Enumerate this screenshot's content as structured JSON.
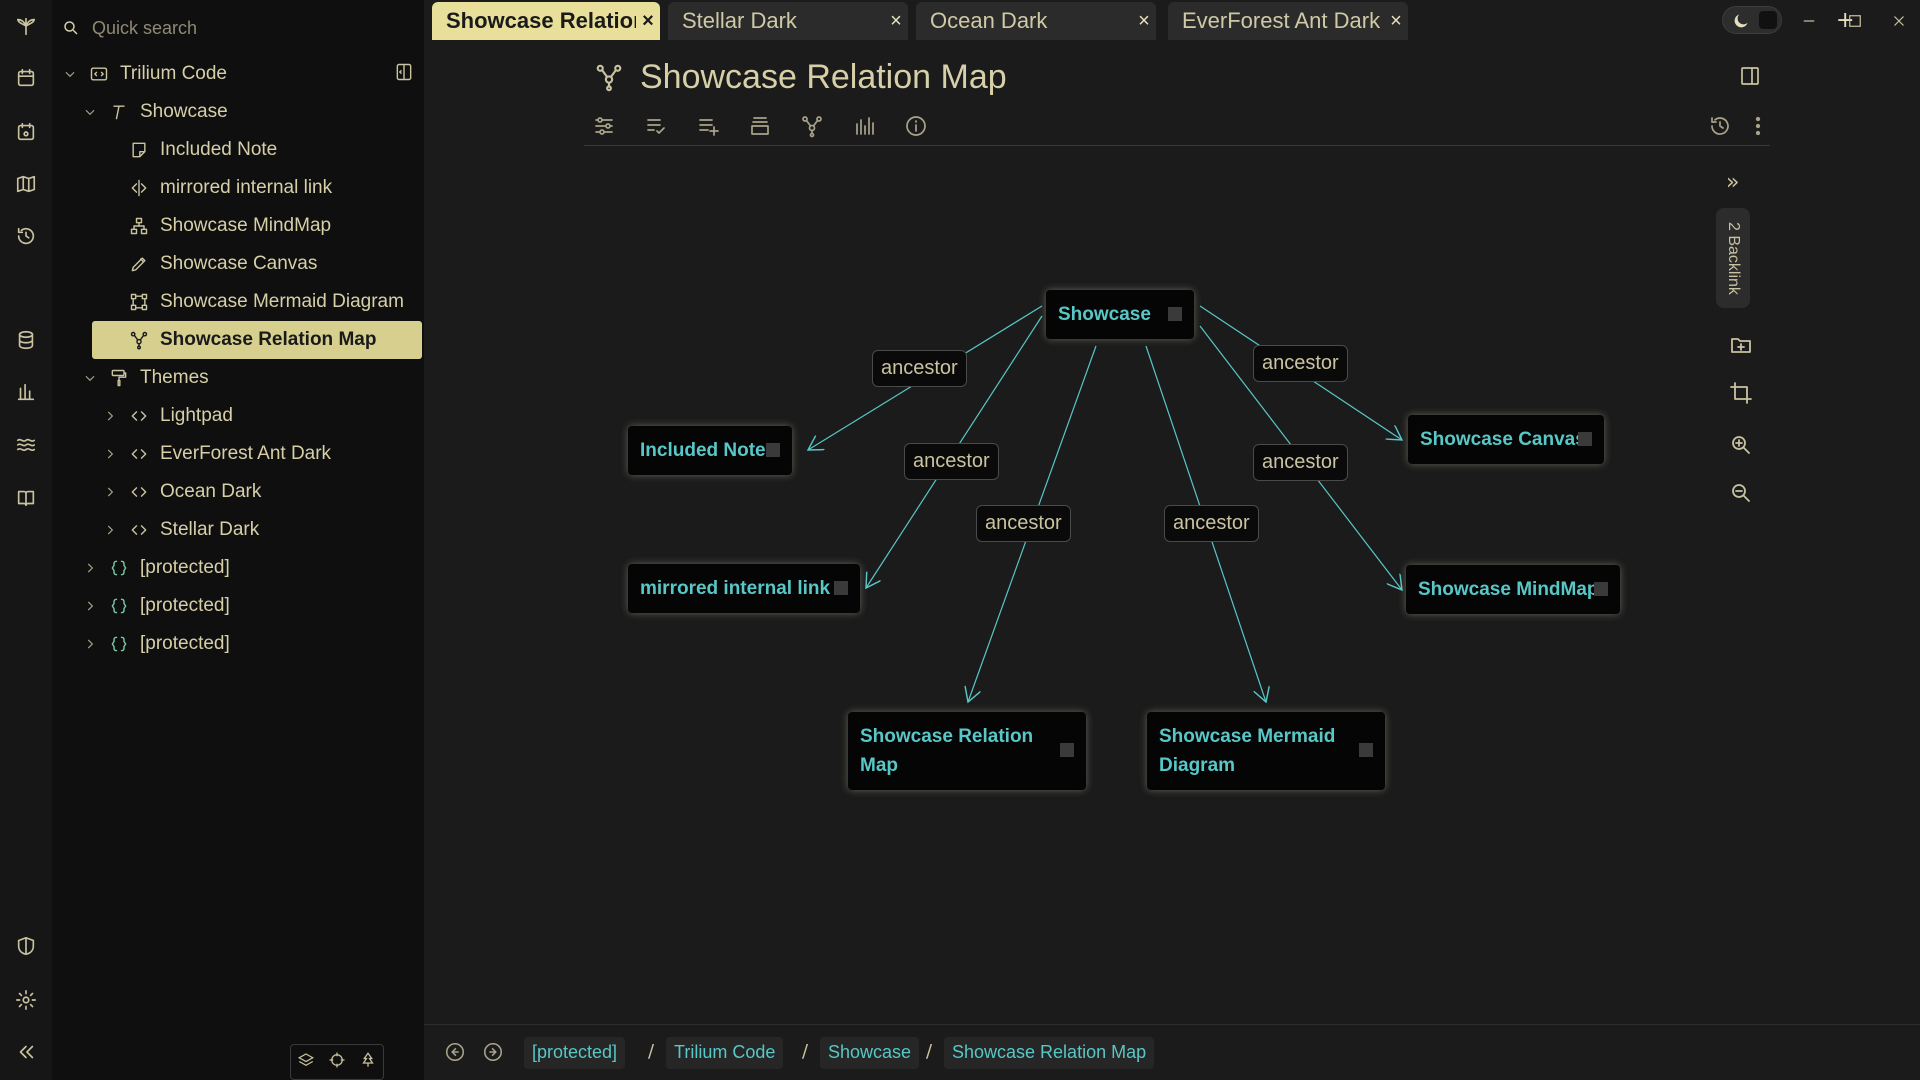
{
  "search": {
    "placeholder": "Quick search"
  },
  "tree": {
    "root": "Trilium Code",
    "items": [
      {
        "label": "Showcase"
      },
      {
        "label": "Included Note"
      },
      {
        "label": "mirrored internal link"
      },
      {
        "label": "Showcase MindMap"
      },
      {
        "label": "Showcase Canvas"
      },
      {
        "label": "Showcase Mermaid Diagram"
      },
      {
        "label": "Showcase Relation Map"
      },
      {
        "label": "Themes"
      },
      {
        "label": "Lightpad"
      },
      {
        "label": "EverForest Ant Dark"
      },
      {
        "label": "Ocean Dark"
      },
      {
        "label": "Stellar Dark"
      },
      {
        "label": "[protected]"
      },
      {
        "label": "[protected]"
      },
      {
        "label": "[protected]"
      }
    ]
  },
  "tabs": [
    {
      "label": "Showcase Relation Map",
      "close": "×"
    },
    {
      "label": "Stellar Dark",
      "close": "×"
    },
    {
      "label": "Ocean Dark",
      "close": "×"
    },
    {
      "label": "EverForest Ant Dark",
      "close": "×"
    }
  ],
  "tab_add": "+",
  "note": {
    "title": "Showcase Relation Map"
  },
  "backlinks": "2 Backlink",
  "expand_label": "»",
  "relation_map": {
    "nodes": [
      {
        "id": "showcase",
        "label": "Showcase"
      },
      {
        "id": "included",
        "label": "Included Note"
      },
      {
        "id": "mirrored",
        "label": "mirrored internal link"
      },
      {
        "id": "canvas",
        "label": "Showcase Canvas"
      },
      {
        "id": "mindmap",
        "label": "Showcase MindMap"
      },
      {
        "id": "relmap",
        "label": "Showcase Relation Map"
      },
      {
        "id": "mermaid",
        "label": "Showcase Mermaid Diagram"
      }
    ],
    "edge_labels": [
      "ancestor",
      "ancestor",
      "ancestor",
      "ancestor",
      "ancestor",
      "ancestor"
    ]
  },
  "breadcrumb": [
    {
      "label": "[protected]"
    },
    {
      "label": "Trilium Code"
    },
    {
      "label": "Showcase"
    },
    {
      "label": "Showcase Relation Map"
    }
  ],
  "breadcrumb_sep": "/",
  "colors": {
    "accent": "#e8e09a",
    "link": "#58c7c7",
    "background": "#1b1b1b"
  }
}
